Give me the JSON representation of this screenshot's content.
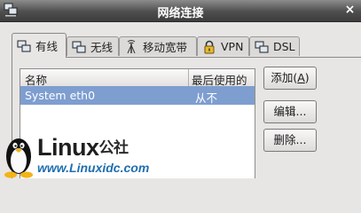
{
  "window": {
    "title": "网络连接",
    "close_glyph": "×"
  },
  "tabs": [
    {
      "label": "有线",
      "icon": "wired-network-icon",
      "active": true
    },
    {
      "label": "无线",
      "icon": "wireless-network-icon",
      "active": false
    },
    {
      "label": "移动宽带",
      "icon": "mobile-broadband-icon",
      "active": false
    },
    {
      "label": "VPN",
      "icon": "lock-icon",
      "active": false
    },
    {
      "label": "DSL",
      "icon": "dsl-network-icon",
      "active": false
    }
  ],
  "list": {
    "columns": [
      "名称",
      "最后使用的"
    ],
    "rows": [
      {
        "name": "System eth0",
        "last_used": "从不",
        "selected": true
      }
    ]
  },
  "buttons": {
    "add": "添加(A)",
    "add_mnemonic": "A",
    "edit": "编辑...",
    "delete": "删除..."
  },
  "watermark": {
    "brand": "Linux",
    "brand_cn": "公社",
    "url": "www.Linuxidc.com"
  },
  "colors": {
    "selection": "#7e9ed0",
    "titlebar": "#4e4e4e",
    "url": "#1f6fb0"
  }
}
